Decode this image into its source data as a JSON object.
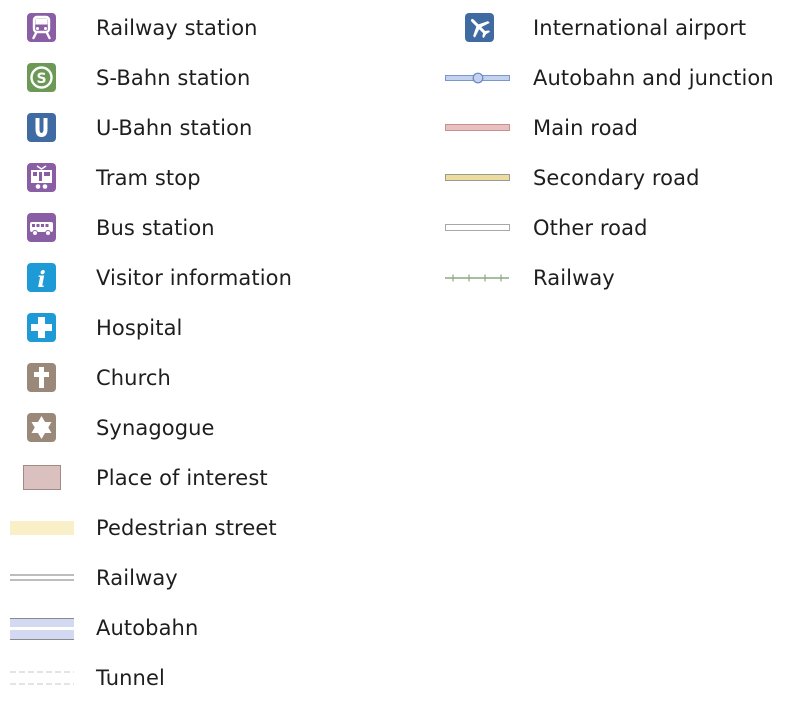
{
  "legend": {
    "left_column": [
      {
        "label": "Railway station",
        "icon": "railway-station-icon",
        "color": "#8a5ea4"
      },
      {
        "label": "S-Bahn station",
        "icon": "s-bahn-icon",
        "color": "#6c9a56"
      },
      {
        "label": "U-Bahn station",
        "icon": "u-bahn-icon",
        "color": "#3f6aa2"
      },
      {
        "label": "Tram stop",
        "icon": "tram-icon",
        "color": "#8a5ea4"
      },
      {
        "label": "Bus station",
        "icon": "bus-icon",
        "color": "#8a5ea4"
      },
      {
        "label": "Visitor information",
        "icon": "info-icon",
        "color": "#1e9ad6"
      },
      {
        "label": "Hospital",
        "icon": "hospital-cross-icon",
        "color": "#1e9ad6"
      },
      {
        "label": "Church",
        "icon": "church-cross-icon",
        "color": "#9a8878"
      },
      {
        "label": "Synagogue",
        "icon": "star-of-david-icon",
        "color": "#9a8878"
      },
      {
        "label": "Place of interest",
        "icon": "place-of-interest-swatch",
        "color": "#dbc0c0"
      },
      {
        "label": "Pedestrian street",
        "icon": "pedestrian-street-swatch",
        "color": "#f9efc8"
      },
      {
        "label": "Railway",
        "icon": "railway-double-line",
        "color": "#bdbdbd"
      },
      {
        "label": "Autobahn",
        "icon": "autobahn-band",
        "color": "#d2d9f0"
      },
      {
        "label": "Tunnel",
        "icon": "tunnel-dashed-line",
        "color": "#c8c8c8"
      }
    ],
    "right_column": [
      {
        "label": "International airport",
        "icon": "airplane-icon",
        "color": "#3f6aa2"
      },
      {
        "label": "Autobahn and junction",
        "icon": "autobahn-junction-line",
        "color": "#c4d2f0"
      },
      {
        "label": "Main road",
        "icon": "main-road-line",
        "color": "#e8c0c0"
      },
      {
        "label": "Secondary road",
        "icon": "secondary-road-line",
        "color": "#ecdca0"
      },
      {
        "label": "Other road",
        "icon": "other-road-line",
        "color": "#ffffff"
      },
      {
        "label": "Railway",
        "icon": "railway-track-line",
        "color": "#8aaa80"
      }
    ]
  }
}
